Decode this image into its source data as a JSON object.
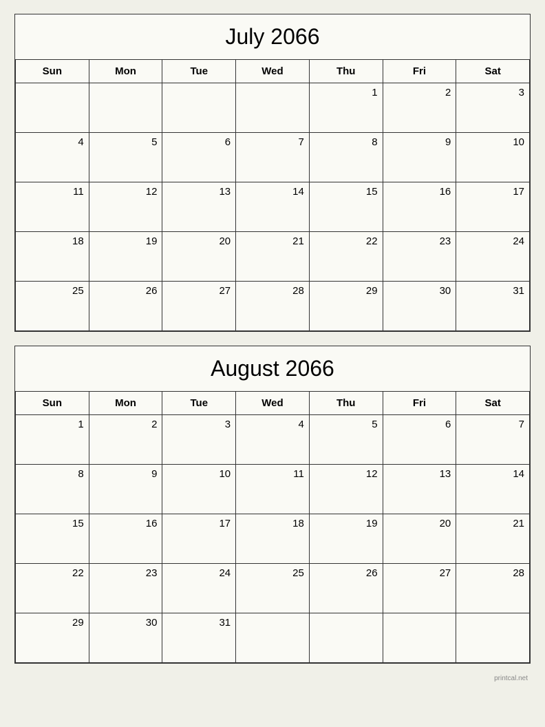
{
  "july": {
    "title": "July 2066",
    "headers": [
      "Sun",
      "Mon",
      "Tue",
      "Wed",
      "Thu",
      "Fri",
      "Sat"
    ],
    "weeks": [
      [
        {
          "day": "",
          "empty": true
        },
        {
          "day": "",
          "empty": true
        },
        {
          "day": "",
          "empty": true
        },
        {
          "day": "",
          "empty": true
        },
        {
          "day": "1",
          "empty": false
        },
        {
          "day": "2",
          "empty": false
        },
        {
          "day": "3",
          "empty": false
        }
      ],
      [
        {
          "day": "4",
          "empty": false
        },
        {
          "day": "5",
          "empty": false
        },
        {
          "day": "6",
          "empty": false
        },
        {
          "day": "7",
          "empty": false
        },
        {
          "day": "8",
          "empty": false
        },
        {
          "day": "9",
          "empty": false
        },
        {
          "day": "10",
          "empty": false
        }
      ],
      [
        {
          "day": "11",
          "empty": false
        },
        {
          "day": "12",
          "empty": false
        },
        {
          "day": "13",
          "empty": false
        },
        {
          "day": "14",
          "empty": false
        },
        {
          "day": "15",
          "empty": false
        },
        {
          "day": "16",
          "empty": false
        },
        {
          "day": "17",
          "empty": false
        }
      ],
      [
        {
          "day": "18",
          "empty": false
        },
        {
          "day": "19",
          "empty": false
        },
        {
          "day": "20",
          "empty": false
        },
        {
          "day": "21",
          "empty": false
        },
        {
          "day": "22",
          "empty": false
        },
        {
          "day": "23",
          "empty": false
        },
        {
          "day": "24",
          "empty": false
        }
      ],
      [
        {
          "day": "25",
          "empty": false
        },
        {
          "day": "26",
          "empty": false
        },
        {
          "day": "27",
          "empty": false
        },
        {
          "day": "28",
          "empty": false
        },
        {
          "day": "29",
          "empty": false
        },
        {
          "day": "30",
          "empty": false
        },
        {
          "day": "31",
          "empty": false
        }
      ]
    ]
  },
  "august": {
    "title": "August 2066",
    "headers": [
      "Sun",
      "Mon",
      "Tue",
      "Wed",
      "Thu",
      "Fri",
      "Sat"
    ],
    "weeks": [
      [
        {
          "day": "1",
          "empty": false
        },
        {
          "day": "2",
          "empty": false
        },
        {
          "day": "3",
          "empty": false
        },
        {
          "day": "4",
          "empty": false
        },
        {
          "day": "5",
          "empty": false
        },
        {
          "day": "6",
          "empty": false
        },
        {
          "day": "7",
          "empty": false
        }
      ],
      [
        {
          "day": "8",
          "empty": false
        },
        {
          "day": "9",
          "empty": false
        },
        {
          "day": "10",
          "empty": false
        },
        {
          "day": "11",
          "empty": false
        },
        {
          "day": "12",
          "empty": false
        },
        {
          "day": "13",
          "empty": false
        },
        {
          "day": "14",
          "empty": false
        }
      ],
      [
        {
          "day": "15",
          "empty": false
        },
        {
          "day": "16",
          "empty": false
        },
        {
          "day": "17",
          "empty": false
        },
        {
          "day": "18",
          "empty": false
        },
        {
          "day": "19",
          "empty": false
        },
        {
          "day": "20",
          "empty": false
        },
        {
          "day": "21",
          "empty": false
        }
      ],
      [
        {
          "day": "22",
          "empty": false
        },
        {
          "day": "23",
          "empty": false
        },
        {
          "day": "24",
          "empty": false
        },
        {
          "day": "25",
          "empty": false
        },
        {
          "day": "26",
          "empty": false
        },
        {
          "day": "27",
          "empty": false
        },
        {
          "day": "28",
          "empty": false
        }
      ],
      [
        {
          "day": "29",
          "empty": false
        },
        {
          "day": "30",
          "empty": false
        },
        {
          "day": "31",
          "empty": false
        },
        {
          "day": "",
          "empty": true
        },
        {
          "day": "",
          "empty": true
        },
        {
          "day": "",
          "empty": true
        },
        {
          "day": "",
          "empty": true
        }
      ]
    ]
  },
  "watermark": "printcal.net"
}
